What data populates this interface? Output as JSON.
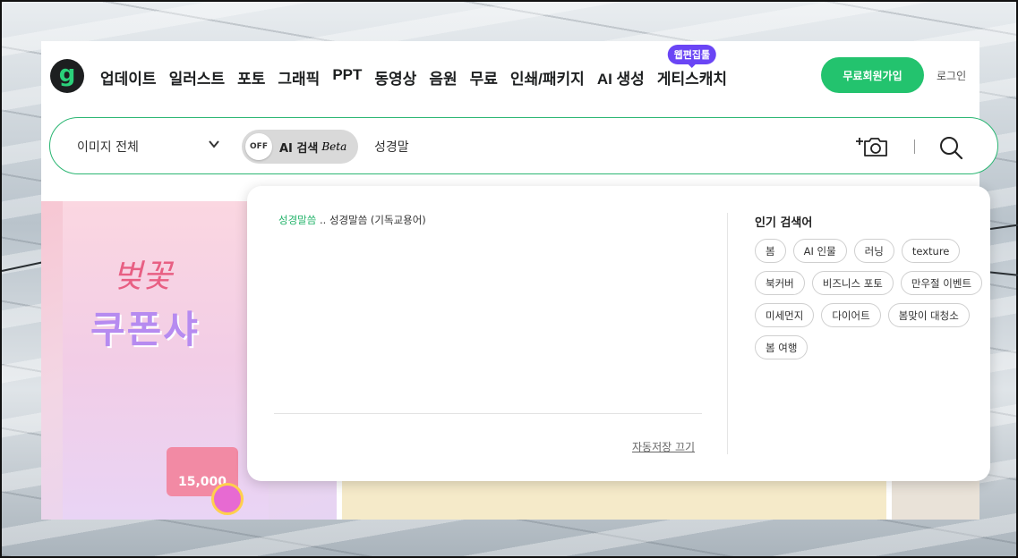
{
  "nav": {
    "logo_text": "g",
    "menu": [
      {
        "label": "업데이트"
      },
      {
        "label": "일러스트"
      },
      {
        "label": "포토"
      },
      {
        "label": "그래픽"
      },
      {
        "label": "PPT"
      },
      {
        "label": "동영상"
      },
      {
        "label": "음원"
      },
      {
        "label": "무료"
      },
      {
        "label": "인쇄/패키지"
      },
      {
        "label": "AI 생성"
      },
      {
        "label": "게티스캐치",
        "badge": "웹편집툴"
      }
    ],
    "join_label": "무료회원가입",
    "login_label": "로그인"
  },
  "search": {
    "scope_label": "이미지 전체",
    "ai_toggle_state": "OFF",
    "ai_label": "AI 검색",
    "ai_beta": "Beta",
    "query": "성경말"
  },
  "dropdown": {
    "suggestion_highlight": "성경말씀",
    "suggestion_rest": " .. 성경말씀 (기독교용어)",
    "autosave_label": "자동저장 끄기",
    "popular_title": "인기 검색어",
    "popular_tags": [
      "봄",
      "AI 인물",
      "러닝",
      "texture",
      "북커버",
      "비즈니스 포토",
      "만우절 이벤트",
      "미세먼지",
      "다이어트",
      "봄맞이 대청소",
      "봄 여행"
    ]
  },
  "banner": {
    "script_text": "벚꽃",
    "title_text": "쿠폰샤",
    "card_text": "15,000"
  },
  "colors": {
    "brand_green": "#23c36e",
    "badge_purple": "#6a45f5",
    "highlight_green": "#23b36a"
  }
}
